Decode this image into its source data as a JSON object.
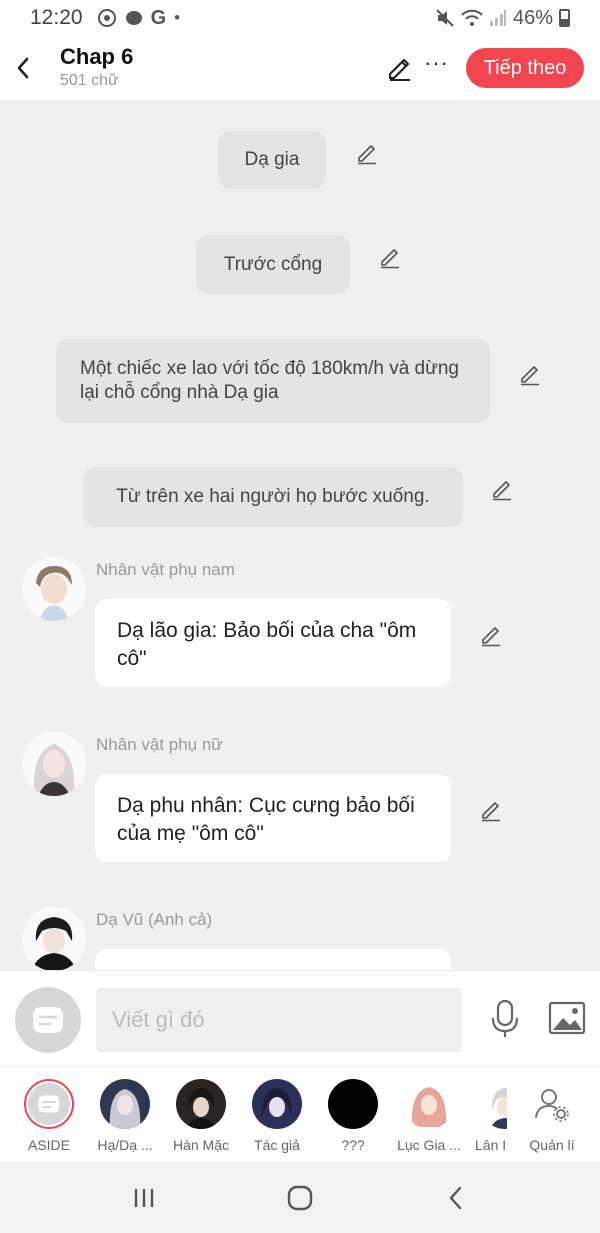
{
  "status": {
    "time": "12:20",
    "battery": "46%",
    "left_icons": [
      "settings-icon",
      "chat-icon",
      "google-icon",
      "dot-icon"
    ],
    "right_icons": [
      "mute-icon",
      "wifi-icon",
      "signal-icon",
      "battery-icon"
    ]
  },
  "header": {
    "title": "Chap 6",
    "word_count": "501 chữ",
    "more_label": "···",
    "next_label": "Tiếp theo"
  },
  "messages": [
    {
      "type": "narration",
      "text": "Dạ gia"
    },
    {
      "type": "narration",
      "text": "Trước cổng"
    },
    {
      "type": "narration",
      "text": "Một chiếc xe lao với tốc độ 180km/h và dừng lại chỗ cổng nhà Dạ gia"
    },
    {
      "type": "narration",
      "text": "Từ trên xe hai người họ bước xuống."
    },
    {
      "type": "dialogue",
      "speaker": "Nhân vật phụ nam",
      "text": "Dạ lão gia: Bảo bối của cha \"ôm cô\""
    },
    {
      "type": "dialogue",
      "speaker": "Nhân vật phụ nữ",
      "text": "Dạ phu nhân: Cục cưng bảo bối của mẹ \"ôm cô\""
    },
    {
      "type": "dialogue",
      "speaker": "Dạ Vũ (Anh cả)",
      "text": ""
    }
  ],
  "input": {
    "placeholder": "Viết gì đó"
  },
  "characters": [
    {
      "name": "ASIDE"
    },
    {
      "name": "Hạ/Dạ ..."
    },
    {
      "name": "Hàn Mặc"
    },
    {
      "name": "Tác giả"
    },
    {
      "name": "???"
    },
    {
      "name": "Lục Gia ..."
    },
    {
      "name": "Lân I"
    },
    {
      "name": "Quản lí"
    }
  ],
  "colors": {
    "accent": "#f2454f",
    "background": "#f0f0f0",
    "narration_bg": "#e4e4e4"
  }
}
